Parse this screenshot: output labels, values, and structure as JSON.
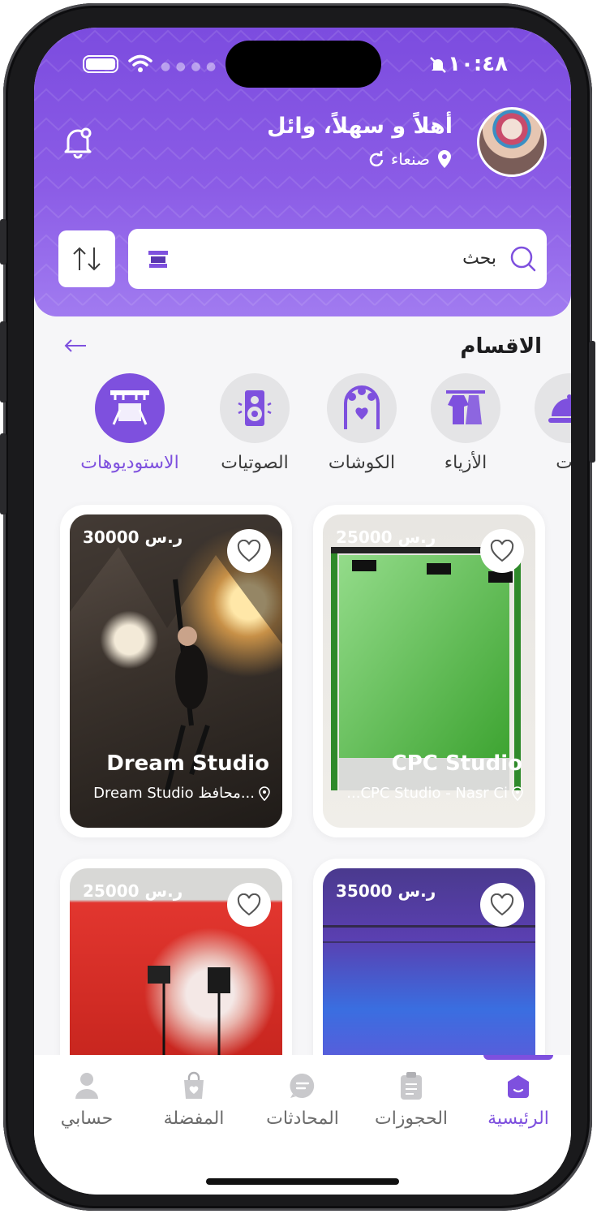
{
  "status_bar": {
    "time": "١٠:٤٨"
  },
  "header": {
    "greeting": "أهلاً و سهلاً، وائل",
    "location": "صنعاء"
  },
  "search": {
    "placeholder": "بحث"
  },
  "categories_section": {
    "title": "الاقسام",
    "items": [
      {
        "label": "الاستوديوهات",
        "icon": "studio-icon",
        "active": true
      },
      {
        "label": "الصوتيات",
        "icon": "speaker-icon",
        "active": false
      },
      {
        "label": "الكوشات",
        "icon": "wedding-arch-icon",
        "active": false
      },
      {
        "label": "الأزياء",
        "icon": "clothes-rack-icon",
        "active": false
      },
      {
        "label": "بات",
        "icon": "food-dish-icon",
        "active": false
      }
    ]
  },
  "studios": [
    {
      "name": "Dream Studio",
      "price": "30000 ر.س",
      "location": "Dream Studio محافظ...",
      "favorite": false
    },
    {
      "name": "CPC Studio",
      "price": "25000 ر.س",
      "location": "...CPC Studio - Nasr Ci",
      "favorite": false
    },
    {
      "name": "",
      "price": "25000 ر.س",
      "location": "",
      "favorite": false
    },
    {
      "name": "",
      "price": "35000 ر.س",
      "location": "",
      "favorite": false
    }
  ],
  "bottom_nav": [
    {
      "label": "الرئيسية",
      "icon": "home-icon",
      "active": true
    },
    {
      "label": "الحجوزات",
      "icon": "bookings-icon",
      "active": false
    },
    {
      "label": "المحادثات",
      "icon": "chat-icon",
      "active": false
    },
    {
      "label": "المفضلة",
      "icon": "favorites-bag-icon",
      "active": false
    },
    {
      "label": "حسابي",
      "icon": "profile-icon",
      "active": false
    }
  ],
  "colors": {
    "primary": "#7e50de",
    "header_top": "#7c4cdf",
    "background": "#f6f6f8"
  }
}
